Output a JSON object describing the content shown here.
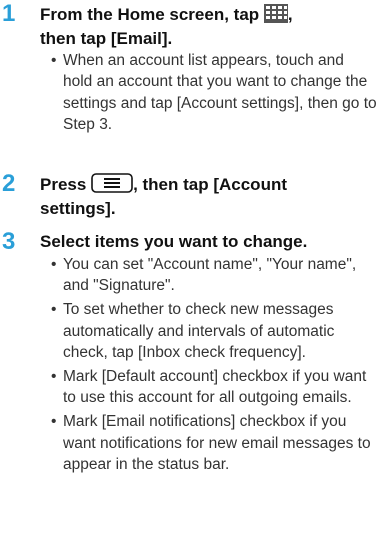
{
  "steps": [
    {
      "number": "1",
      "title_before_icon": "From the Home screen, tap",
      "title_icon": "app-grid-icon",
      "title_after_icon": ",",
      "title_line2": "then tap [Email].",
      "bullets": [
        "When an account list appears, touch and hold an account that you want to change the settings and tap [Account settings], then go to Step 3."
      ]
    },
    {
      "number": "2",
      "title_before_icon": "Press",
      "title_icon": "menu-key-icon",
      "title_after_icon": ", then tap [Account",
      "title_line2": "settings]."
    },
    {
      "number": "3",
      "title": "Select items you want to change.",
      "bullets": [
        "You can set \"Account name\", \"Your name\", and \"Signature\".",
        "To set whether to check new messages automatically and intervals of automatic check, tap [Inbox check frequency].",
        "Mark [Default account] checkbox if you want to use this account for all outgoing emails.",
        "Mark [Email notifications] checkbox if you want notifications for new email messages to appear in the status bar."
      ]
    }
  ],
  "bullet_glyph": "•",
  "colors": {
    "step_number": "#2a9fd8",
    "title_text": "#111111",
    "body_text": "#333333"
  }
}
